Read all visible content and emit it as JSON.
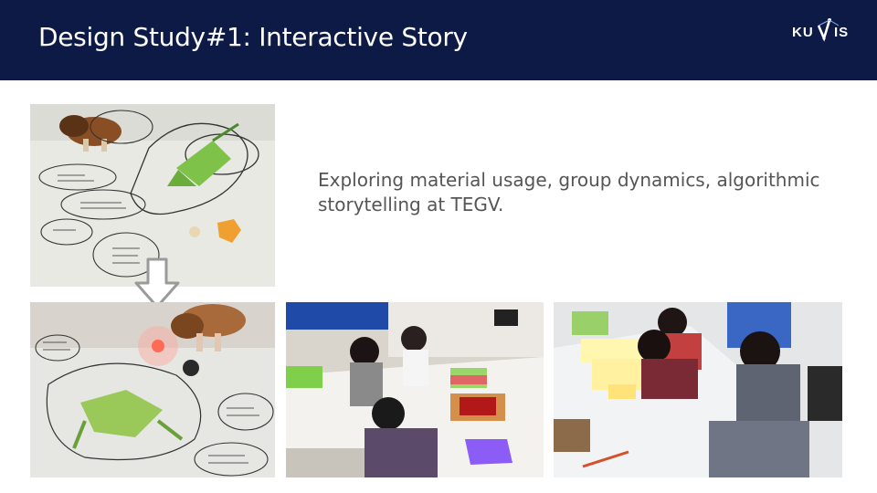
{
  "slide": {
    "title": "Design Study#1: Interactive Story",
    "caption": "Exploring material usage, group dynamics, algorithmic storytelling at TEGV.",
    "logo_text": "KU IS"
  },
  "colors": {
    "header_bg": "#0c1a45",
    "caption_text": "#555555"
  },
  "photos": [
    {
      "name": "story-drawing-photo"
    },
    {
      "name": "robot-lizard-photo"
    },
    {
      "name": "children-classroom-photo"
    },
    {
      "name": "children-sticky-notes-photo"
    }
  ],
  "icons": [
    "down-arrow-icon",
    "kuis-logo-icon"
  ]
}
